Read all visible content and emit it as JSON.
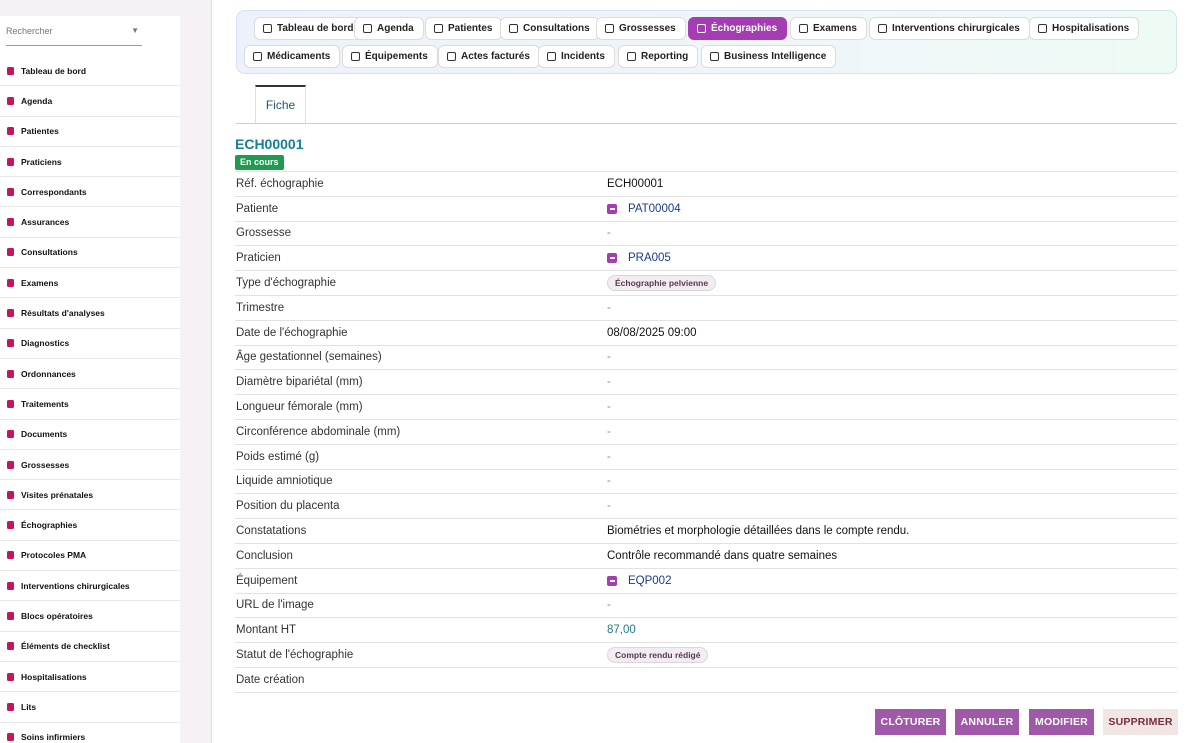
{
  "search": {
    "placeholder": "Rechercher"
  },
  "sidebar": {
    "items": [
      {
        "label": "Tableau de bord",
        "icon": "dashboard-icon"
      },
      {
        "label": "Agenda",
        "icon": "calendar-icon"
      },
      {
        "label": "Patientes",
        "icon": "female-icon"
      },
      {
        "label": "Praticiens",
        "icon": "user-md-icon"
      },
      {
        "label": "Correspondants",
        "icon": "address-icon"
      },
      {
        "label": "Assurances",
        "icon": "shield-icon"
      },
      {
        "label": "Consultations",
        "icon": "stethoscope-icon"
      },
      {
        "label": "Examens",
        "icon": "exam-icon"
      },
      {
        "label": "Résultats d'analyses",
        "icon": "lab-icon"
      },
      {
        "label": "Diagnostics",
        "icon": "clipboard-icon"
      },
      {
        "label": "Ordonnances",
        "icon": "prescription-icon"
      },
      {
        "label": "Traitements",
        "icon": "pills-icon"
      },
      {
        "label": "Documents",
        "icon": "file-icon"
      },
      {
        "label": "Grossesses",
        "icon": "pregnancy-icon"
      },
      {
        "label": "Visites prénatales",
        "icon": "calendar-check-icon"
      },
      {
        "label": "Échographies",
        "icon": "image-icon"
      },
      {
        "label": "Protocoles PMA",
        "icon": "hourglass-icon"
      },
      {
        "label": "Interventions chirurgicales",
        "icon": "bed-icon"
      },
      {
        "label": "Blocs opératoires",
        "icon": "hospital-icon"
      },
      {
        "label": "Éléments de checklist",
        "icon": "checklist-icon"
      },
      {
        "label": "Hospitalisations",
        "icon": "hospital-user-icon"
      },
      {
        "label": "Lits",
        "icon": "bed-icon"
      },
      {
        "label": "Soins infirmiers",
        "icon": "nurse-icon"
      }
    ]
  },
  "tabs": [
    {
      "label": "Tableau de bord",
      "icon": "dashboard-icon"
    },
    {
      "label": "Agenda",
      "icon": "calendar-icon"
    },
    {
      "label": "Patientes",
      "icon": "female-icon"
    },
    {
      "label": "Consultations",
      "icon": "stethoscope-icon"
    },
    {
      "label": "Grossesses",
      "icon": "pregnancy-icon"
    },
    {
      "label": "Échographies",
      "icon": "image-icon",
      "active": true
    },
    {
      "label": "Examens",
      "icon": "exam-icon"
    },
    {
      "label": "Interventions chirurgicales",
      "icon": "bed-icon"
    },
    {
      "label": "Hospitalisations",
      "icon": "hospital-user-icon"
    },
    {
      "label": "Médicaments",
      "icon": "pills-icon"
    },
    {
      "label": "Équipements",
      "icon": "heartbeat-icon"
    },
    {
      "label": "Actes facturés",
      "icon": "invoice-icon"
    },
    {
      "label": "Incidents",
      "icon": "warning-icon"
    },
    {
      "label": "Reporting",
      "icon": "pie-chart-icon"
    },
    {
      "label": "Business Intelligence",
      "icon": "line-chart-icon"
    }
  ],
  "subtab": {
    "label": "Fiche"
  },
  "record": {
    "title": "ECH00001",
    "status": "En cours",
    "fields": [
      {
        "label": "Réf. échographie",
        "value": "ECH00001",
        "type": "text"
      },
      {
        "label": "Patiente",
        "value": "PAT00004",
        "type": "link"
      },
      {
        "label": "Grossesse",
        "value": "-",
        "type": "dash"
      },
      {
        "label": "Praticien",
        "value": "PRA005",
        "type": "link"
      },
      {
        "label": "Type d'échographie",
        "value": "Échographie pelvienne",
        "type": "pill"
      },
      {
        "label": "Trimestre",
        "value": "-",
        "type": "dash"
      },
      {
        "label": "Date de l'échographie",
        "value": "08/08/2025 09:00",
        "type": "text"
      },
      {
        "label": "Âge gestationnel (semaines)",
        "value": "-",
        "type": "dash"
      },
      {
        "label": "Diamètre bipariétal (mm)",
        "value": "-",
        "type": "dash"
      },
      {
        "label": "Longueur fémorale (mm)",
        "value": "-",
        "type": "dash"
      },
      {
        "label": "Circonférence abdominale (mm)",
        "value": "-",
        "type": "dash"
      },
      {
        "label": "Poids estimé (g)",
        "value": "-",
        "type": "dash"
      },
      {
        "label": "Liquide amniotique",
        "value": "-",
        "type": "dash"
      },
      {
        "label": "Position du placenta",
        "value": "-",
        "type": "dash"
      },
      {
        "label": "Constatations",
        "value": "Biométries et morphologie détaillées dans le compte rendu.",
        "type": "text"
      },
      {
        "label": "Conclusion",
        "value": "Contrôle recommandé dans quatre semaines",
        "type": "text"
      },
      {
        "label": "Équipement",
        "value": "EQP002",
        "type": "link"
      },
      {
        "label": "URL de l'image",
        "value": "-",
        "type": "dash"
      },
      {
        "label": "Montant HT",
        "value": "87,00",
        "type": "money"
      },
      {
        "label": "Statut de l'échographie",
        "value": "Compte rendu rédigé",
        "type": "pill"
      },
      {
        "label": "Date création",
        "value": "",
        "type": "text"
      }
    ]
  },
  "actions": {
    "close": "CLÔTURER",
    "cancel": "ANNULER",
    "edit": "MODIFIER",
    "delete": "SUPPRIMER"
  },
  "colors": {
    "accent": "#a43cb4",
    "status_green": "#1e9b4f",
    "title_teal": "#168096",
    "button_purple": "#a058a8"
  }
}
